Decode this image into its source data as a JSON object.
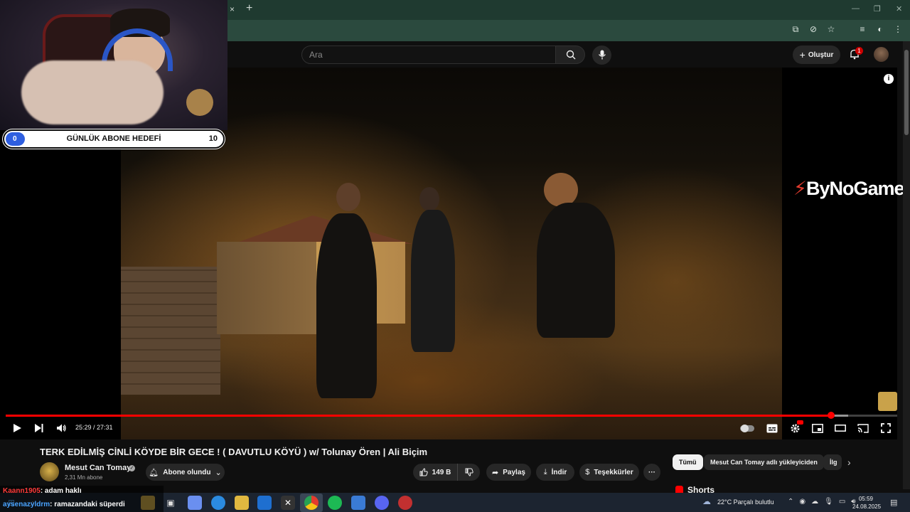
{
  "browser": {
    "tab_close": "×",
    "tab_new": "+",
    "win_min": "—",
    "win_restore": "❐",
    "win_close": "✕"
  },
  "header": {
    "search_placeholder": "Ara",
    "create_label": "Oluştur",
    "notification_count": "1"
  },
  "video": {
    "current_time": "25:29",
    "duration": "27:31",
    "time_text": "25:29 / 27:31",
    "progress_fraction": 0.926,
    "buffer_fraction": 0.945,
    "info_glyph": "i",
    "watermark_brand": "ByNoGame"
  },
  "stream_overlay": {
    "goal_current": "0",
    "goal_label": "GÜNLÜK ABONE HEDEFİ",
    "goal_target": "10",
    "goal_fraction": 0.09
  },
  "meta": {
    "title": "TERK EDİLMİŞ CİNLİ KÖYDE BİR GECE ! ( DAVUTLU KÖYÜ ) w/ Tolunay Ören | Ali Biçim",
    "channel_name": "Mesut Can Tomay",
    "subscribers": "2,31 Mn abone",
    "subscribe_label": "Abone olundu",
    "likes": "149 B",
    "share_label": "Paylaş",
    "download_label": "İndir",
    "thanks_label": "Teşekkürler",
    "more_label": "···"
  },
  "side": {
    "chips": [
      {
        "label": "Tümü"
      },
      {
        "label": "Mesut Can Tomay adlı yükleyiciden"
      },
      {
        "label": "İlg"
      }
    ],
    "shorts_label": "Shorts"
  },
  "chat": [
    {
      "user": "Kaann1905",
      "message": ": adam haklı",
      "color": "#ff3b3b"
    },
    {
      "user": "aysenazyldrm",
      "message": ": ramazandaki süperdi",
      "color": "#4aa3ff"
    }
  ],
  "taskbar": {
    "weather": "22°C  Parçalı bulutlu",
    "time": "05:59",
    "date": "24.08.2025"
  },
  "colors": {
    "accent_red": "#ff0000",
    "chrome_green": "#1f3a30",
    "goal_blue": "#2f5fe0"
  }
}
